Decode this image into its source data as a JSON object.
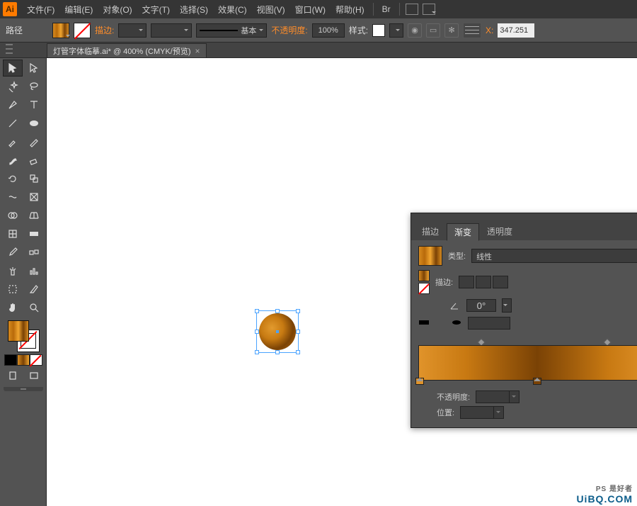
{
  "app": {
    "logo": "Ai"
  },
  "menu": {
    "file": "文件(F)",
    "edit": "编辑(E)",
    "object": "对象(O)",
    "type": "文字(T)",
    "select": "选择(S)",
    "effect": "效果(C)",
    "view": "视图(V)",
    "window": "窗口(W)",
    "help": "帮助(H)",
    "br": "Br"
  },
  "control": {
    "mode": "路径",
    "stroke_label": "描边:",
    "brush_label": "基本",
    "opacity_label": "不透明度:",
    "opacity_value": "100%",
    "style_label": "样式:",
    "coord_x_label": "X:",
    "coord_x_value": "347.251"
  },
  "tab": {
    "title": "灯管字体临摹.ai* @ 400% (CMYK/预览)"
  },
  "panel": {
    "tabs": {
      "stroke": "描边",
      "gradient": "渐变",
      "transparency": "透明度"
    },
    "type_label": "类型:",
    "type_value": "线性",
    "stroke_label": "描边:",
    "angle_value": "0°",
    "opacity_label": "不透明度:",
    "location_label": "位置:"
  },
  "watermark": {
    "text": "UiBQ.COM",
    "sub": "PS 是好者"
  },
  "chart_data": {
    "type": "gradient",
    "gradient_type": "linear",
    "angle": 0,
    "stops": [
      {
        "position": 0,
        "color": "#e0932a"
      },
      {
        "position": 50,
        "color": "#7a4205"
      },
      {
        "position": 100,
        "color": "#e0932a"
      }
    ],
    "midpoints": [
      25,
      75
    ]
  }
}
